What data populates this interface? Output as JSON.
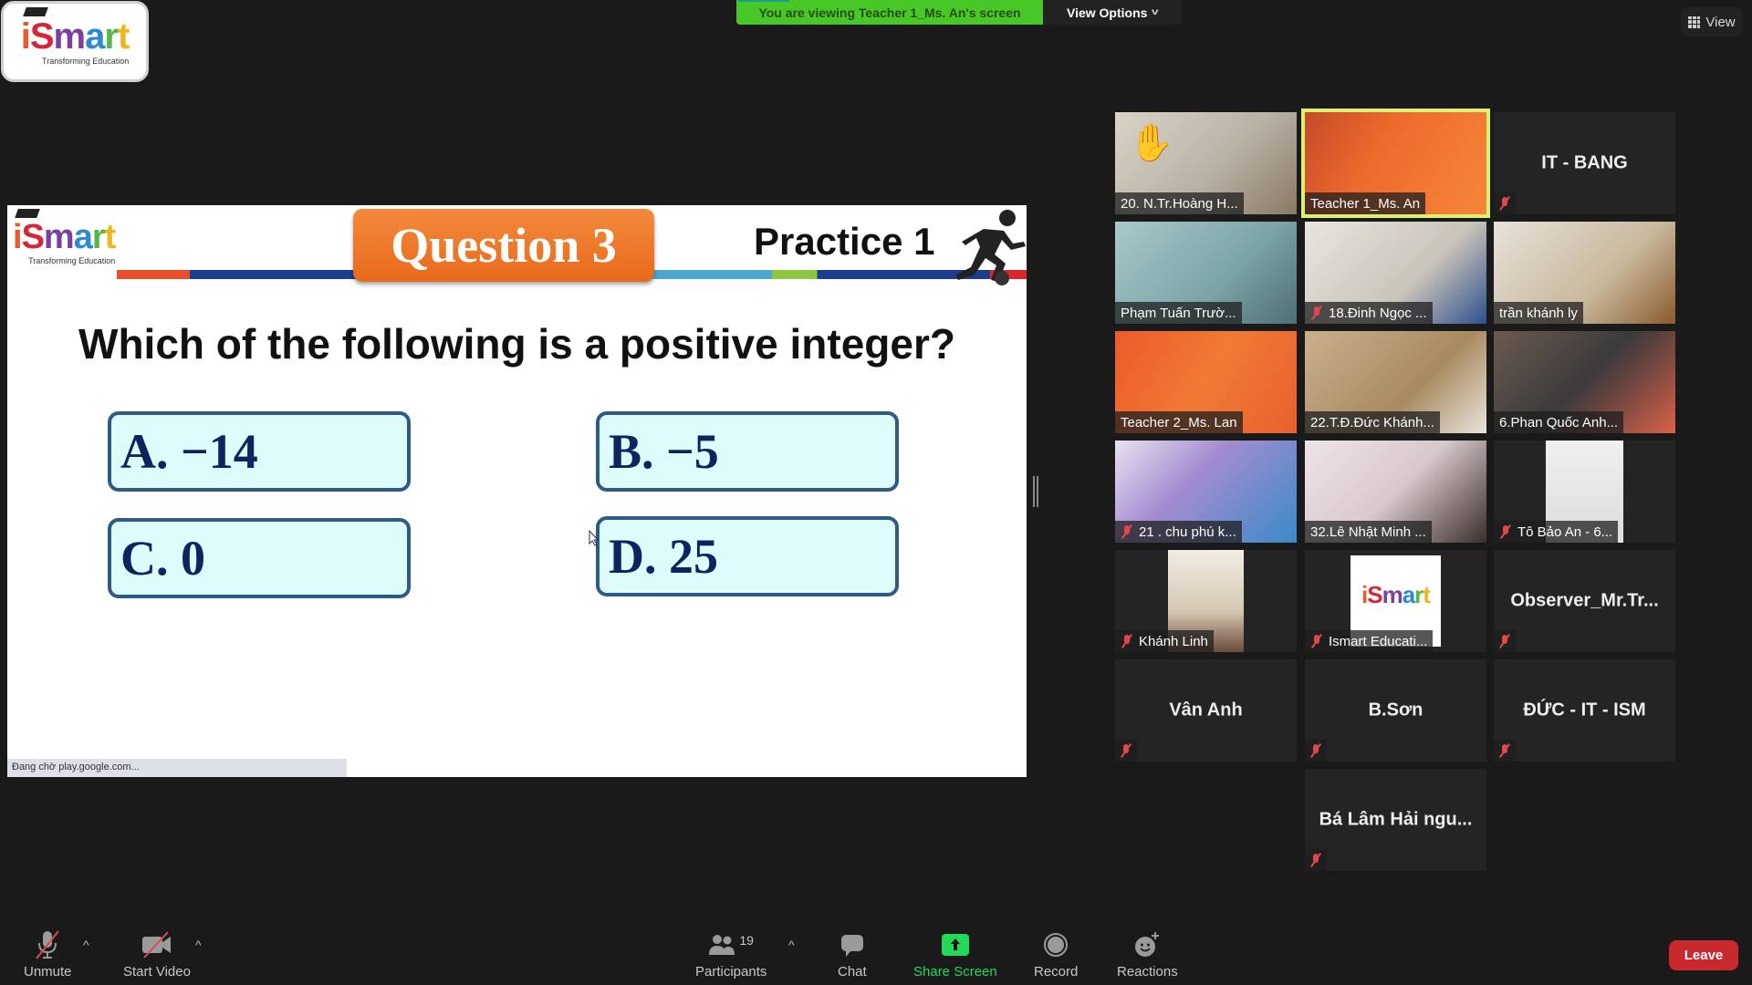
{
  "app": {
    "logo": {
      "word": "iSmart",
      "tagline": "Transforming Education"
    },
    "viewing_banner": "You are viewing Teacher 1_Ms. An's screen",
    "view_options_label": "View Options",
    "view_label": "View"
  },
  "slide": {
    "logo": {
      "word": "iSmart",
      "tagline": "Transforming Education"
    },
    "badge": "Question 3",
    "practice": "Practice 1",
    "question": "Which of the following is a positive integer?",
    "answers": [
      {
        "id": "A",
        "text": "A. −14"
      },
      {
        "id": "B",
        "text": "B. −5"
      },
      {
        "id": "C",
        "text": "C. 0"
      },
      {
        "id": "D",
        "text": "D. 25"
      }
    ],
    "status_bar": "Đang chờ play.google.com..."
  },
  "gallery": {
    "tiles": [
      {
        "name": "20. N.Tr.Hoàng H...",
        "video": true,
        "muted": false,
        "raised_hand": true,
        "active": false
      },
      {
        "name": "Teacher 1_Ms. An",
        "video": true,
        "muted": false,
        "raised_hand": false,
        "active": true
      },
      {
        "name": "IT - BANG",
        "video": false,
        "muted": true,
        "raised_hand": false,
        "active": false
      },
      {
        "name": "Phạm Tuấn Trườ...",
        "video": true,
        "muted": false,
        "raised_hand": false,
        "active": false
      },
      {
        "name": "18.Đinh Ngọc ...",
        "video": true,
        "muted": true,
        "raised_hand": false,
        "active": false
      },
      {
        "name": "trần khánh ly",
        "video": true,
        "muted": false,
        "raised_hand": false,
        "active": false
      },
      {
        "name": "Teacher 2_Ms. Lan",
        "video": true,
        "muted": false,
        "raised_hand": false,
        "active": false
      },
      {
        "name": "22.T.Đ.Đức Khánh...",
        "video": true,
        "muted": false,
        "raised_hand": false,
        "active": false
      },
      {
        "name": "6.Phan Quốc Anh...",
        "video": true,
        "muted": false,
        "raised_hand": false,
        "active": false
      },
      {
        "name": "21 . chu phú k...",
        "video": true,
        "muted": true,
        "raised_hand": false,
        "active": false
      },
      {
        "name": "32.Lê Nhật Minh ...",
        "video": true,
        "muted": false,
        "raised_hand": false,
        "active": false
      },
      {
        "name": "Tô Bảo An - 6...",
        "video": true,
        "muted": true,
        "raised_hand": false,
        "active": false
      },
      {
        "name": "Khánh Linh",
        "video": true,
        "muted": true,
        "raised_hand": false,
        "active": false
      },
      {
        "name": "Ismart Educati...",
        "video": true,
        "muted": true,
        "raised_hand": false,
        "active": false
      },
      {
        "name": "Observer_Mr.Tr...",
        "video": false,
        "muted": true,
        "raised_hand": false,
        "active": false
      },
      {
        "name": "Vân Anh",
        "video": false,
        "muted": true,
        "raised_hand": false,
        "active": false
      },
      {
        "name": "B.Sơn",
        "video": false,
        "muted": true,
        "raised_hand": false,
        "active": false
      },
      {
        "name": "ĐỨC - IT - ISM",
        "video": false,
        "muted": true,
        "raised_hand": false,
        "active": false
      },
      {
        "name": "Bá Lâm Hải ngu...",
        "video": false,
        "muted": true,
        "raised_hand": false,
        "active": false
      }
    ]
  },
  "toolbar": {
    "unmute": "Unmute",
    "start_video": "Start Video",
    "participants": "Participants",
    "participants_count": "19",
    "chat": "Chat",
    "share_screen": "Share Screen",
    "record": "Record",
    "reactions": "Reactions",
    "leave": "Leave"
  },
  "colors": {
    "banner_green": "#47c826",
    "share_green": "#23d959",
    "leave_red": "#c9282d",
    "active_speaker": "#dcf26a",
    "muted_red": "#e0474c"
  }
}
